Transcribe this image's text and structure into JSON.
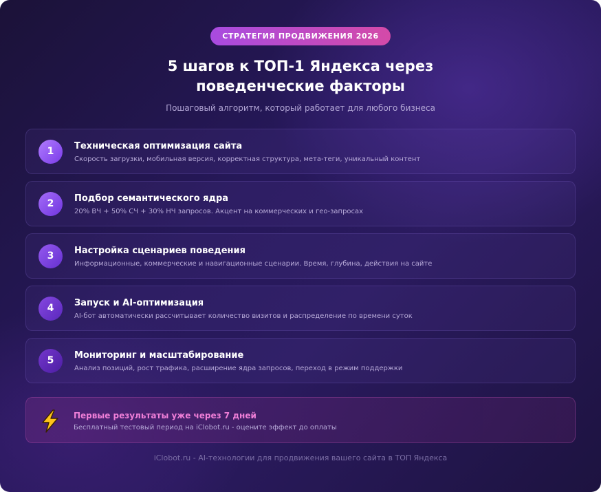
{
  "header": {
    "badge": "СТРАТЕГИЯ ПРОДВИЖЕНИЯ 2026",
    "title_line1": "5 шагов к ТОП-1 Яндекса через",
    "title_line2": "поведенческие факторы",
    "subtitle": "Пошаговый алгоритм, который работает для любого бизнеса"
  },
  "steps": [
    {
      "number": "1",
      "title": "Техническая оптимизация сайта",
      "description": "Скорость загрузки, мобильная версия, корректная структура, мета-теги, уникальный контент"
    },
    {
      "number": "2",
      "title": "Подбор семантического ядра",
      "description": "20% ВЧ + 50% СЧ + 30% НЧ запросов. Акцент на коммерческих и гео-запросах"
    },
    {
      "number": "3",
      "title": "Настройка сценариев поведения",
      "description": "Информационные, коммерческие и навигационные сценарии. Время, глубина, действия на сайте"
    },
    {
      "number": "4",
      "title": "Запуск и AI-оптимизация",
      "description": "AI-бот автоматически рассчитывает количество визитов и распределение по времени суток"
    },
    {
      "number": "5",
      "title": "Мониторинг и масштабирование",
      "description": "Анализ позиций, рост трафика, расширение ядра запросов, переход в режим поддержки"
    }
  ],
  "promo": {
    "icon": "lightning-icon",
    "title": "Первые результаты уже через 7 дней",
    "description": "Бесплатный тестовый период на iClobot.ru - оцените эффект до оплаты"
  },
  "footer": {
    "text": "iClobot.ru - AI-технологии для продвижения вашего сайта в ТОП Яндекса"
  },
  "colors": {
    "accent_pink": "#f07fd8",
    "accent_purple": "#a84be0"
  }
}
